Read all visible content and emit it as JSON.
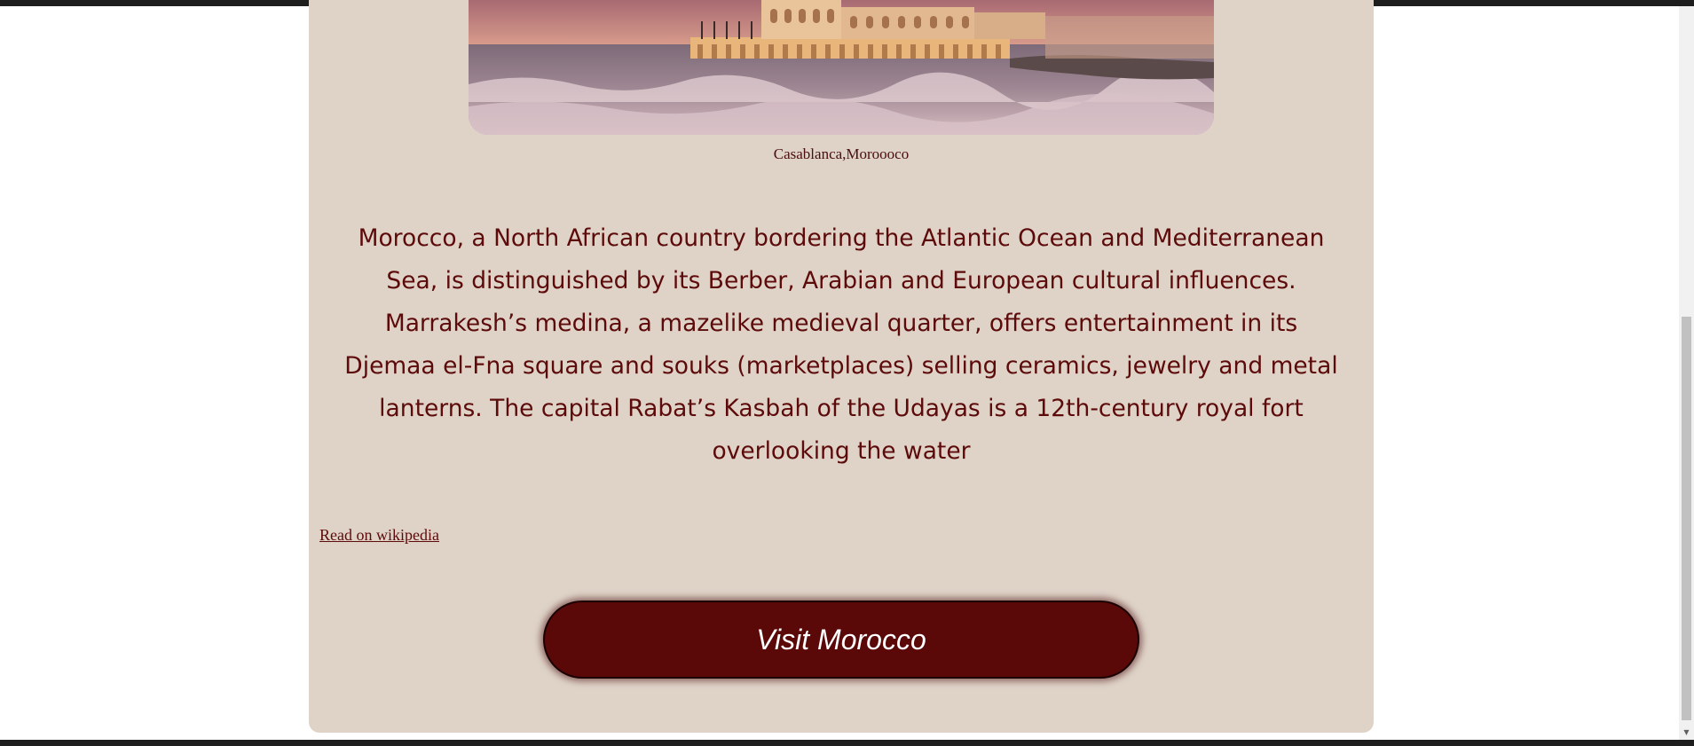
{
  "hero": {
    "image_alt": "Hassan II Mosque on the coast at sunset",
    "caption": "Casablanca,Moroooco"
  },
  "description": "Morocco, a North African country bordering the Atlantic Ocean and Mediterranean Sea, is distinguished by its Berber, Arabian and European cultural influences. Marrakesh’s medina, a mazelike medieval quarter, offers entertainment in its Djemaa el-Fna square and souks (marketplaces) selling ceramics, jewelry and metal lanterns. The capital Rabat’s Kasbah of the Udayas is a 12th-century royal fort overlooking the water",
  "links": {
    "wiki_label": "Read on wikipedia"
  },
  "cta": {
    "label": "Visit Morocco"
  },
  "colors": {
    "card_background": "#dfd3c8",
    "text": "#5c0a0a",
    "button": "#5a0808"
  },
  "icons": {
    "scroll_down": "chevron-down-icon"
  }
}
